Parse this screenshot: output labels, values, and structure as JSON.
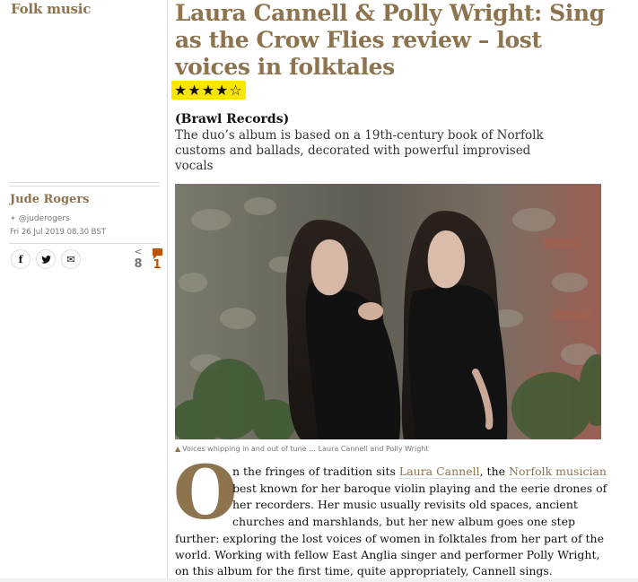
{
  "section": {
    "kicker": "Folk music"
  },
  "headline": "Laura Cannell & Polly Wright: Sing as the Crow Flies review – lost voices in folktales",
  "rating": {
    "stars": "★★★★☆",
    "value": 4,
    "max": 5
  },
  "standfirst": {
    "label": "(Brawl Records)",
    "text": "The duo’s album is based on a 19th-century book of Norfolk customs and ballads, decorated with powerful improvised vocals"
  },
  "byline": {
    "author": "Jude Rogers",
    "twitter": "@juderogers",
    "date": "Fri 26 Jul 2019 08.30 BST"
  },
  "share": {
    "facebook_icon": "f",
    "twitter_icon": "◆",
    "email_icon": "✉",
    "share_icon": "<",
    "share_count": "8",
    "comment_count": "1"
  },
  "image": {
    "caption": "Voices whipping in and out of tune … Laura Cannell and Polly Wright"
  },
  "body": {
    "dropcap": "O",
    "line1_pre": "n the fringes of tradition sits ",
    "link1": "Laura Cannell",
    "line1_mid": ", the ",
    "link2": "Norfolk musician",
    "line2": "best known for her baroque violin playing and the eerie drones of",
    "line3": "her recorders. Her music usually revisits old spaces, ancient",
    "line4": "churches and marshlands, but her new album goes one step",
    "line5": "further: exploring the lost voices of women in folktales from her part of the",
    "line6": "world. Working with fellow East Anglia singer and performer Polly Wright,",
    "line7": "on this album for the first time, quite appropriately, Cannell sings."
  }
}
